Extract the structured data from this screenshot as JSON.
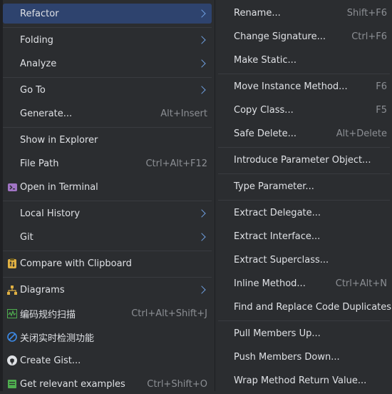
{
  "left_menu": [
    {
      "label": "Refactor",
      "submenu": true,
      "selected": true
    },
    {
      "label": "Folding",
      "submenu": true
    },
    {
      "label": "Analyze",
      "submenu": true
    },
    {
      "label": "Go To",
      "submenu": true
    },
    {
      "label": "Generate...",
      "shortcut": "Alt+Insert"
    },
    {
      "label": "Show in Explorer"
    },
    {
      "label": "File Path",
      "shortcut": "Ctrl+Alt+F12"
    },
    {
      "label": "Open in Terminal",
      "icon": "terminal-icon"
    },
    {
      "label": "Local History",
      "submenu": true
    },
    {
      "label": "Git",
      "submenu": true
    },
    {
      "label": "Compare with Clipboard",
      "icon": "compare-clipboard-icon"
    },
    {
      "label": "Diagrams",
      "submenu": true,
      "icon": "diagrams-icon"
    },
    {
      "label": "编码规约扫描",
      "shortcut": "Ctrl+Alt+Shift+J",
      "icon": "code-scan-icon"
    },
    {
      "label": "关闭实时检测功能",
      "icon": "disable-realtime-icon"
    },
    {
      "label": "Create Gist...",
      "icon": "github-icon"
    },
    {
      "label": "Get relevant examples",
      "shortcut": "Ctrl+Shift+O",
      "icon": "examples-icon"
    }
  ],
  "right_menu": [
    {
      "label": "Rename...",
      "shortcut": "Shift+F6"
    },
    {
      "label": "Change Signature...",
      "shortcut": "Ctrl+F6"
    },
    {
      "label": "Make Static..."
    },
    {
      "label": "Move Instance Method...",
      "shortcut": "F6"
    },
    {
      "label": "Copy Class...",
      "shortcut": "F5"
    },
    {
      "label": "Safe Delete...",
      "shortcut": "Alt+Delete"
    },
    {
      "label": "Introduce Parameter Object..."
    },
    {
      "label": "Type Parameter..."
    },
    {
      "label": "Extract Delegate..."
    },
    {
      "label": "Extract Interface..."
    },
    {
      "label": "Extract Superclass..."
    },
    {
      "label": "Inline Method...",
      "shortcut": "Ctrl+Alt+N"
    },
    {
      "label": "Find and Replace Code Duplicates..."
    },
    {
      "label": "Pull Members Up..."
    },
    {
      "label": "Push Members Down..."
    },
    {
      "label": "Wrap Method Return Value..."
    }
  ],
  "colors": {
    "background": "#2b2d30",
    "selection": "#2e436e",
    "separator": "#393b40",
    "shortcut": "#8c8f94",
    "submenu_arrow": "#6f9fe0"
  }
}
